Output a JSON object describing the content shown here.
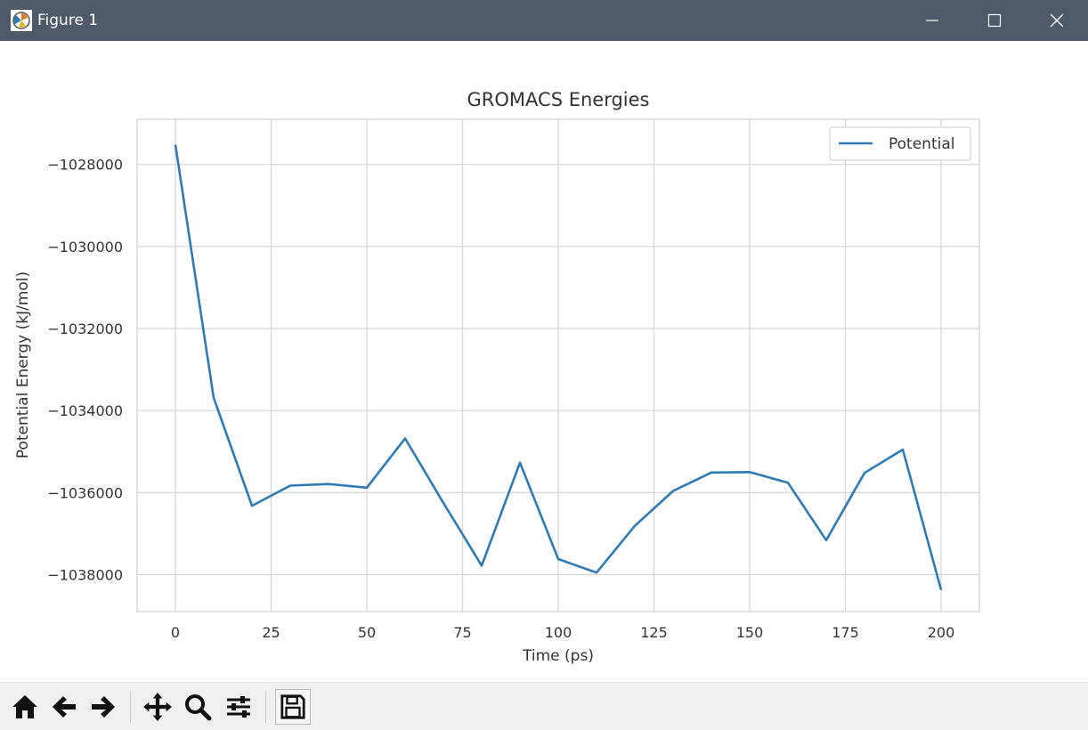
{
  "window": {
    "title": "Figure 1",
    "app_icon": "matplotlib-icon",
    "controls": [
      "minimize-icon",
      "maximize-icon",
      "close-icon"
    ]
  },
  "toolbar": {
    "buttons": [
      {
        "name": "home-button",
        "icon": "home-icon"
      },
      {
        "name": "back-button",
        "icon": "arrow-left-icon"
      },
      {
        "name": "forward-button",
        "icon": "arrow-right-icon"
      },
      {
        "name": "pan-button",
        "icon": "move-icon"
      },
      {
        "name": "zoom-button",
        "icon": "zoom-icon"
      },
      {
        "name": "configure-subplots-button",
        "icon": "sliders-icon"
      },
      {
        "name": "save-button",
        "icon": "save-icon"
      }
    ]
  },
  "colors": {
    "titlebar": "#4d5a69",
    "series": "#2d7bb6",
    "grid": "#d6d6d6",
    "toolbar": "#f0f0f0"
  },
  "chart_data": {
    "type": "line",
    "title": "GROMACS Energies",
    "xlabel": "Time (ps)",
    "ylabel": "Potential Energy (kJ/mol)",
    "xlim": [
      -10,
      210
    ],
    "ylim": [
      -1038900,
      -1026900
    ],
    "xticks": [
      0,
      25,
      50,
      75,
      100,
      125,
      150,
      175,
      200
    ],
    "yticks": [
      -1038000,
      -1036000,
      -1034000,
      -1032000,
      -1030000,
      -1028000
    ],
    "xtick_labels": [
      "0",
      "25",
      "50",
      "75",
      "100",
      "125",
      "150",
      "175",
      "200"
    ],
    "ytick_labels": [
      "−1038000",
      "−1036000",
      "−1034000",
      "−1032000",
      "−1030000",
      "−1028000"
    ],
    "grid": true,
    "legend": "top-right",
    "series": [
      {
        "name": "Potential",
        "color": "#2d7bb6",
        "x": [
          0,
          10,
          20,
          30,
          40,
          50,
          60,
          70,
          80,
          90,
          100,
          110,
          120,
          130,
          140,
          150,
          160,
          170,
          180,
          190,
          200
        ],
        "y": [
          -1027520,
          -1033690,
          -1036320,
          -1035830,
          -1035790,
          -1035880,
          -1034680,
          -1036250,
          -1037780,
          -1035270,
          -1037620,
          -1037950,
          -1036810,
          -1035960,
          -1035510,
          -1035500,
          -1035760,
          -1037160,
          -1035520,
          -1034950,
          -1038370
        ]
      }
    ]
  }
}
